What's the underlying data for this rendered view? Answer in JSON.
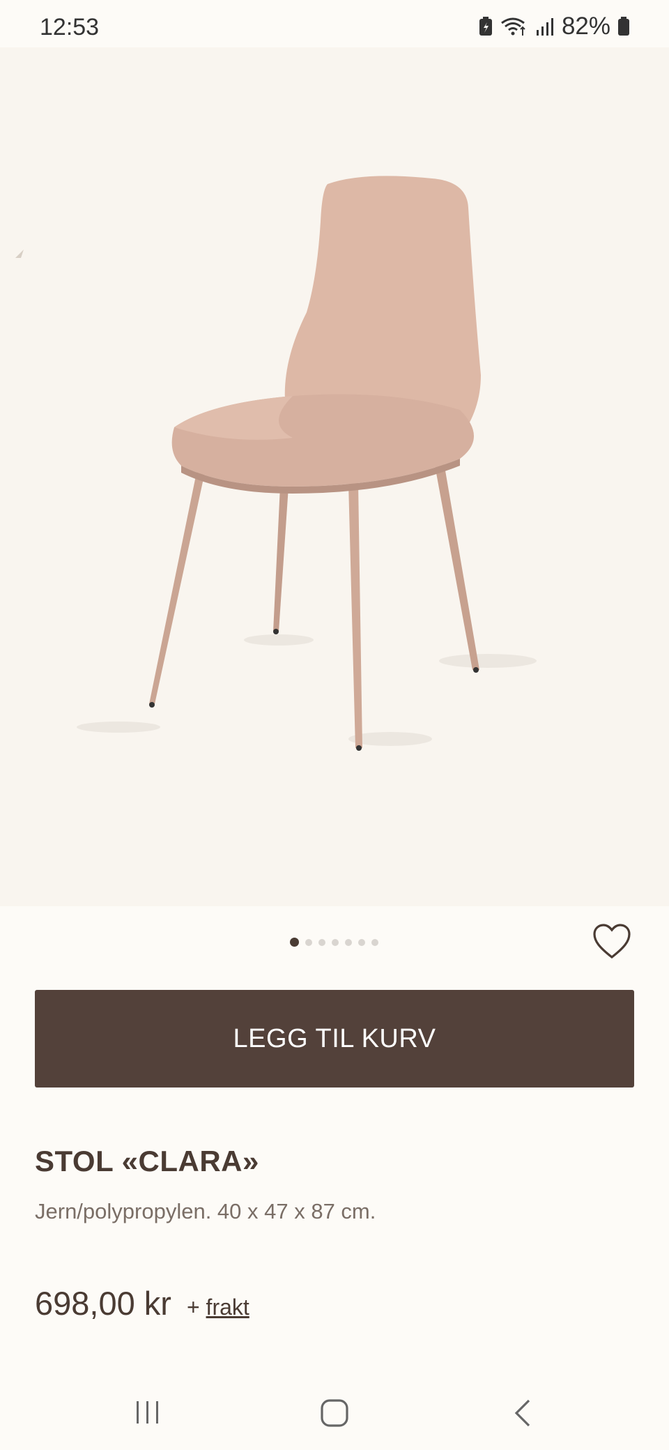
{
  "status_bar": {
    "time": "12:53",
    "battery_percent": "82%",
    "icons": [
      "battery-saver-icon",
      "wifi-icon",
      "signal-icon",
      "battery-icon"
    ]
  },
  "product": {
    "image_alt": "chair-image",
    "carousel": {
      "total": 7,
      "active_index": 0
    },
    "add_to_cart_label": "LEGG TIL KURV",
    "title": "STOL «CLARA»",
    "description": "Jern/polypropylen. 40 x 47 x 87 cm.",
    "price": "698,00 kr",
    "shipping_prefix": "+",
    "shipping_link": "frakt"
  },
  "nav": {
    "icons": [
      "recent-apps-icon",
      "home-icon",
      "back-icon"
    ]
  },
  "colors": {
    "background": "#fdfbf7",
    "hero_background": "#f9f5ef",
    "button": "#53413a",
    "text": "#4a3b33",
    "chair": "#d6b09f"
  }
}
